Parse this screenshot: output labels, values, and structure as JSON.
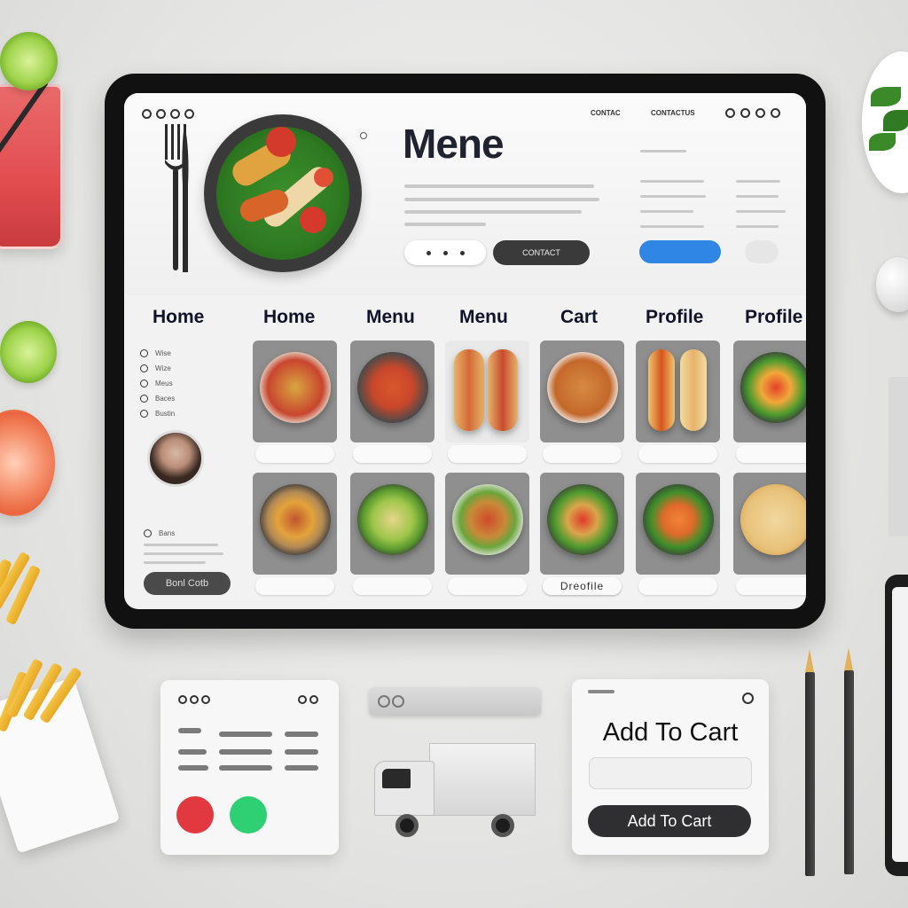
{
  "app": {
    "title": "Mene",
    "header_right_1": "CONTAC",
    "header_right_2": "CONTACTUS"
  },
  "nav": [
    "Home",
    "Home",
    "Menu",
    "Menu",
    "Cart",
    "Profile",
    "Profile"
  ],
  "hero": {
    "button_label": "CONTACT"
  },
  "sidebar": {
    "items": [
      "Wise",
      "Wize",
      "Meus",
      "Baces",
      "Bustin"
    ],
    "note": "Bans",
    "button_label": "Bonl Cotb"
  },
  "menu_grid": {
    "row1": [
      {
        "label": "",
        "dish": "tomato-salad"
      },
      {
        "label": "",
        "dish": "cherry-tomatoes"
      },
      {
        "label": "",
        "dish": "hot-dogs"
      },
      {
        "label": "",
        "dish": "curry-soup"
      },
      {
        "label": "",
        "dish": "sandwich"
      },
      {
        "label": "",
        "dish": "roasted-peppers"
      }
    ],
    "row2": [
      {
        "label": "",
        "dish": "roasted-vegetables"
      },
      {
        "label": "",
        "dish": "green-salad"
      },
      {
        "label": "",
        "dish": "noodle-bowl"
      },
      {
        "label": "",
        "dish": "mixed-salad"
      },
      {
        "label": "",
        "dish": "salmon-salad"
      },
      {
        "label": "",
        "dish": "pizza"
      }
    ],
    "profile_label": "Dreofile"
  },
  "order_panel": {
    "action_colors": [
      "#e2383f",
      "#2fcf73",
      "#2f86e4"
    ]
  },
  "add_to_cart": {
    "title": "Add To Cart",
    "button_label": "Add To Cart"
  }
}
